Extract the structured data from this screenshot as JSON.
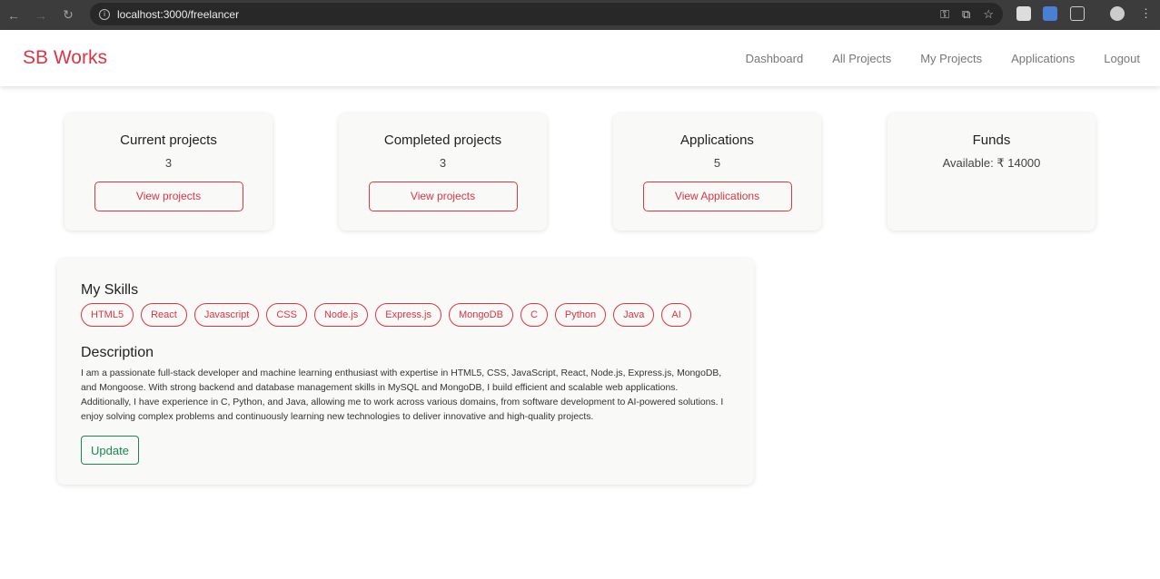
{
  "browser": {
    "url": "localhost:3000/freelancer"
  },
  "navbar": {
    "brand": "SB Works",
    "links": [
      "Dashboard",
      "All Projects",
      "My Projects",
      "Applications",
      "Logout"
    ]
  },
  "cards": [
    {
      "title": "Current projects",
      "value": "3",
      "button": "View projects"
    },
    {
      "title": "Completed projects",
      "value": "3",
      "button": "View projects"
    },
    {
      "title": "Applications",
      "value": "5",
      "button": "View Applications"
    },
    {
      "title": "Funds",
      "value": "Available: ₹ 14000"
    }
  ],
  "skills": {
    "heading": "My Skills",
    "items": [
      "HTML5",
      "React",
      "Javascript",
      "CSS",
      "Node.js",
      "Express.js",
      "MongoDB",
      "C",
      "Python",
      "Java",
      "AI"
    ]
  },
  "description": {
    "heading": "Description",
    "text": "I am a passionate full-stack developer and machine learning enthusiast with expertise in HTML5, CSS, JavaScript, React, Node.js, Express.js, MongoDB, and Mongoose. With strong backend and database management skills in MySQL and MongoDB, I build efficient and scalable web applications. Additionally, I have experience in C, Python, and Java, allowing me to work across various domains, from software development to AI-powered solutions. I enjoy solving complex problems and continuously learning new technologies to deliver innovative and high-quality projects.",
    "update_label": "Update"
  },
  "colors": {
    "accent": "#dc3545",
    "success": "#198754"
  }
}
